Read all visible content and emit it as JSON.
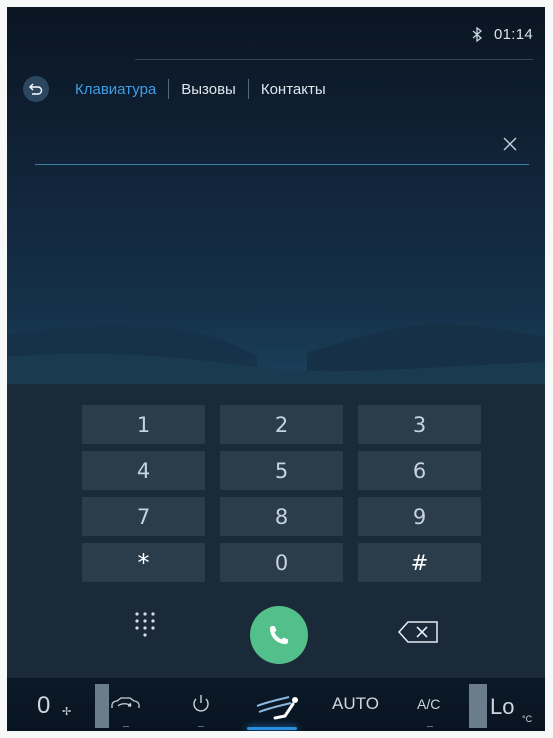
{
  "status": {
    "time": "01:14",
    "bluetooth_icon": "bluetooth-icon"
  },
  "tabs": [
    {
      "label": "Клавиатура",
      "active": true
    },
    {
      "label": "Вызовы",
      "active": false
    },
    {
      "label": "Контакты",
      "active": false
    }
  ],
  "input": {
    "value": "",
    "placeholder": ""
  },
  "keypad": {
    "keys": [
      "1",
      "2",
      "3",
      "4",
      "5",
      "6",
      "7",
      "8",
      "9",
      "*",
      "0",
      "#"
    ]
  },
  "actions": {
    "dialpad_icon": "dialpad-icon",
    "call_icon": "phone-icon",
    "backspace_icon": "backspace-icon"
  },
  "climate": {
    "fan_level": "0",
    "mode": "AUTO",
    "ac": "A/C",
    "temperature": "Lo",
    "temperature_unit": "°C"
  },
  "colors": {
    "accent": "#3d9ee7",
    "call": "#53c08b",
    "key_bg": "#2b3c4b"
  }
}
